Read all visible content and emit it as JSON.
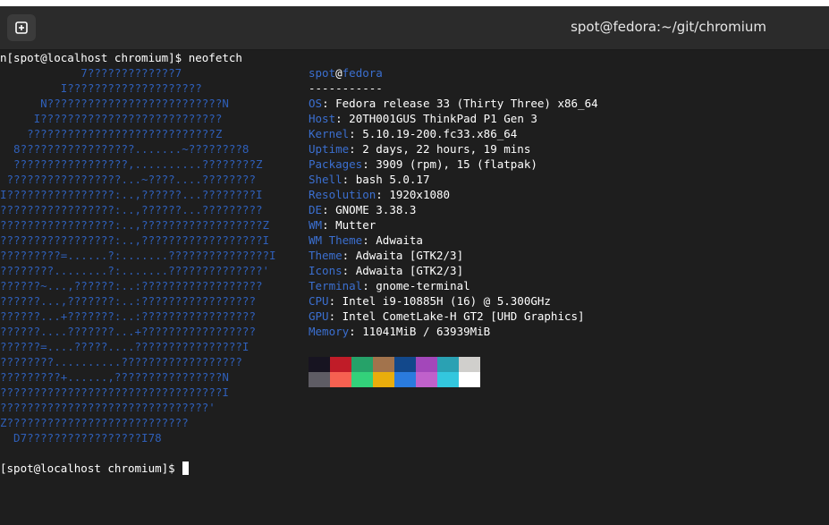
{
  "window": {
    "title": "spot@fedora:~/git/chromium"
  },
  "terminal": {
    "command_line": "n[spot@localhost chromium]$ neofetch",
    "prompt": "[spot@localhost chromium]$ ",
    "ascii_art": [
      "            7?????????????7",
      "         I????????????????????",
      "      N??????????????????????????N",
      "     I???????????????????????????",
      "    ????????????????????????????Z",
      "  8?????????????????.......~????????8",
      "  ?????????????????,..........????????Z",
      " ?????????????????...~????....????????",
      "I????????????????:..,??????...????????I",
      "?????????????????:..,??????...?????????",
      "?????????????????:..,??????????????????Z",
      "?????????????????:..,??????????????????I",
      "?????????=......?:.......???????????????I",
      "????????........?:.......??????????????'",
      "??????~...,??????:..:??????????????????",
      "??????...,???????:..:?????????????????",
      "??????...+???????:..:?????????????????",
      "??????....???????...+?????????????????",
      "??????=....?????....????????????????I",
      "????????..........??????????????????",
      "?????????+......,????????????????N",
      "?????????????????????????????????I",
      "???????????????????????????????'",
      "Z???????????????????????????",
      "  D7?????????????????I78"
    ],
    "user": "spot",
    "at": "@",
    "host": "fedora",
    "separator": "-----------",
    "info": [
      {
        "key": "OS",
        "value": "Fedora release 33 (Thirty Three) x86_64"
      },
      {
        "key": "Host",
        "value": "20TH001GUS ThinkPad P1 Gen 3"
      },
      {
        "key": "Kernel",
        "value": "5.10.19-200.fc33.x86_64"
      },
      {
        "key": "Uptime",
        "value": "2 days, 22 hours, 19 mins"
      },
      {
        "key": "Packages",
        "value": "3909 (rpm), 15 (flatpak)"
      },
      {
        "key": "Shell",
        "value": "bash 5.0.17"
      },
      {
        "key": "Resolution",
        "value": "1920x1080"
      },
      {
        "key": "DE",
        "value": "GNOME 3.38.3"
      },
      {
        "key": "WM",
        "value": "Mutter"
      },
      {
        "key": "WM Theme",
        "value": "Adwaita"
      },
      {
        "key": "Theme",
        "value": "Adwaita [GTK2/3]"
      },
      {
        "key": "Icons",
        "value": "Adwaita [GTK2/3]"
      },
      {
        "key": "Terminal",
        "value": "gnome-terminal"
      },
      {
        "key": "CPU",
        "value": "Intel i9-10885H (16) @ 5.300GHz"
      },
      {
        "key": "GPU",
        "value": "Intel CometLake-H GT2 [UHD Graphics]"
      },
      {
        "key": "Memory",
        "value": "11041MiB / 63939MiB"
      }
    ],
    "palette_dark": [
      "#171421",
      "#c01c28",
      "#26a269",
      "#a2734c",
      "#12488b",
      "#a347ba",
      "#2aa1b3",
      "#d0cfcc"
    ],
    "palette_bright": [
      "#5e5c64",
      "#f66151",
      "#33d17a",
      "#e9ad0c",
      "#2a7bde",
      "#c061cb",
      "#33c7de",
      "#ffffff"
    ]
  },
  "icons": {
    "new_tab": "new-tab-icon"
  }
}
